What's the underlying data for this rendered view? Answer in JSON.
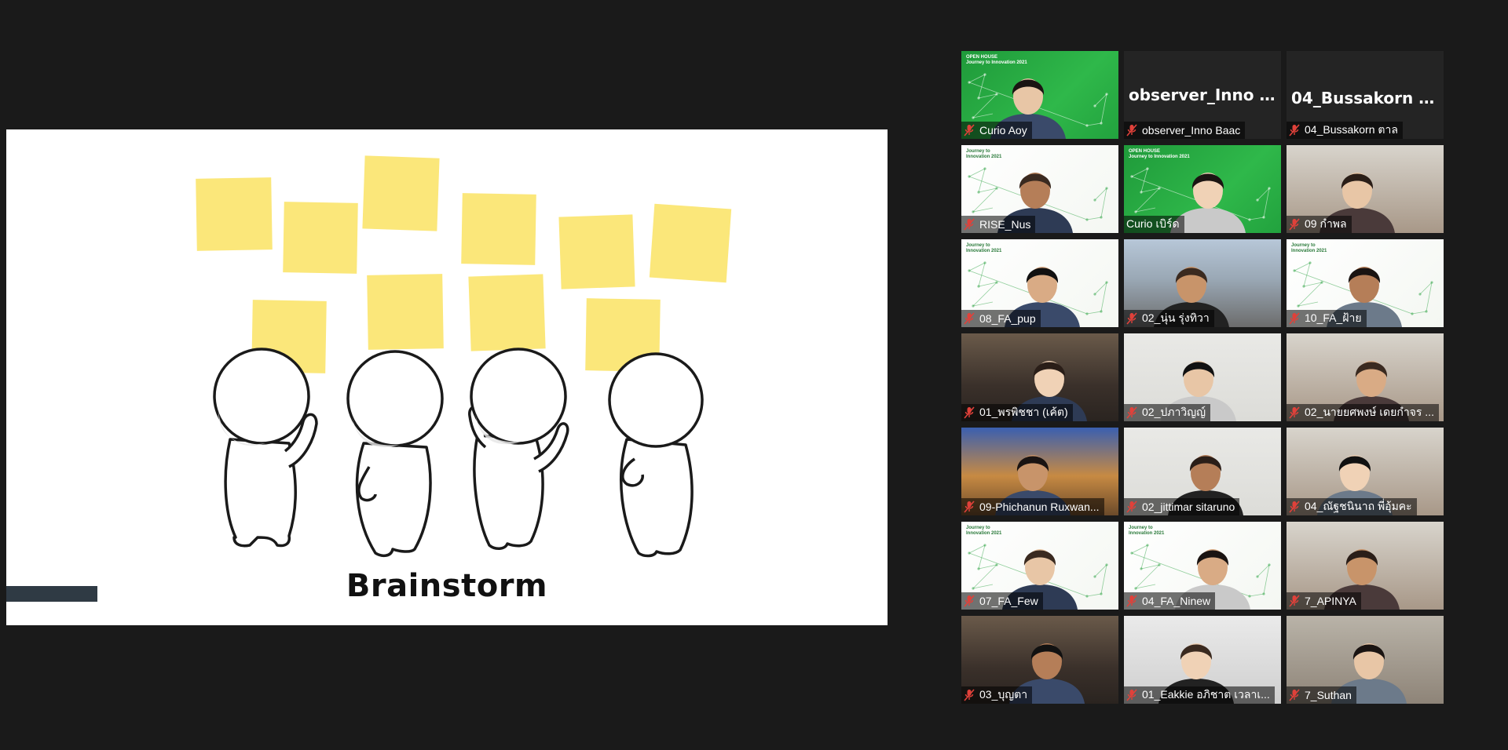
{
  "share": {
    "title": "Brainstorm"
  },
  "participants": [
    {
      "display_name": "Curio Aoy",
      "muted": true,
      "video": "green-slide"
    },
    {
      "display_name": "observer_Inno Baac",
      "big_name": "observer_Inno B...",
      "muted": true,
      "video": "off"
    },
    {
      "display_name": "04_Bussakorn ตาล",
      "big_name": "04_Bussakorn ตาล",
      "muted": true,
      "video": "off"
    },
    {
      "display_name": "RISE_Nus",
      "muted": true,
      "video": "white-slide"
    },
    {
      "display_name": "Curio เบิร์ด",
      "muted": false,
      "video": "green-slide",
      "active_speaker": true
    },
    {
      "display_name": "09 กำพล",
      "muted": true,
      "video": "room"
    },
    {
      "display_name": "08_FA_pup",
      "muted": true,
      "video": "white-slide"
    },
    {
      "display_name": "02_นุ่น รุ่งทิวา",
      "muted": true,
      "video": "street"
    },
    {
      "display_name": "10_FA_ฝ้าย",
      "muted": true,
      "video": "white-slide"
    },
    {
      "display_name": "01_พรพิชชา (เค้ต)",
      "muted": true,
      "video": "room"
    },
    {
      "display_name": "02_ปภาวิญญ์",
      "muted": true,
      "video": "room"
    },
    {
      "display_name": "02_นายยศพงษ์ เดยกำจร ...",
      "muted": true,
      "video": "room"
    },
    {
      "display_name": "09-Phichanun Ruxwan...",
      "muted": true,
      "video": "market"
    },
    {
      "display_name": "02_jittimar sitaruno",
      "muted": true,
      "video": "room"
    },
    {
      "display_name": "04_ณัฐชนินาถ พี่อุ้มคะ",
      "muted": true,
      "video": "room"
    },
    {
      "display_name": "07_FA_Few",
      "muted": true,
      "video": "white-slide"
    },
    {
      "display_name": "04_FA_Ninew",
      "muted": true,
      "video": "white-slide"
    },
    {
      "display_name": "7_APINYA",
      "muted": true,
      "video": "room"
    },
    {
      "display_name": "03_บุญตา",
      "muted": true,
      "video": "room"
    },
    {
      "display_name": "01_Eakkie อภิชาต เวลาเ...",
      "muted": true,
      "video": "office"
    },
    {
      "display_name": "7_Suthan",
      "muted": true,
      "video": "room"
    }
  ],
  "slide_brand": {
    "line1": "OPEN HOUSE",
    "line2": "Journey to Innovation 2021",
    "alt_line1": "Journey to",
    "alt_line2": "Innovation 2021"
  },
  "colors": {
    "background": "#1a1a1a",
    "active_speaker_border": "#e6dd4c",
    "muted_icon": "#e0413a",
    "sticky_note": "#fbe77a"
  }
}
